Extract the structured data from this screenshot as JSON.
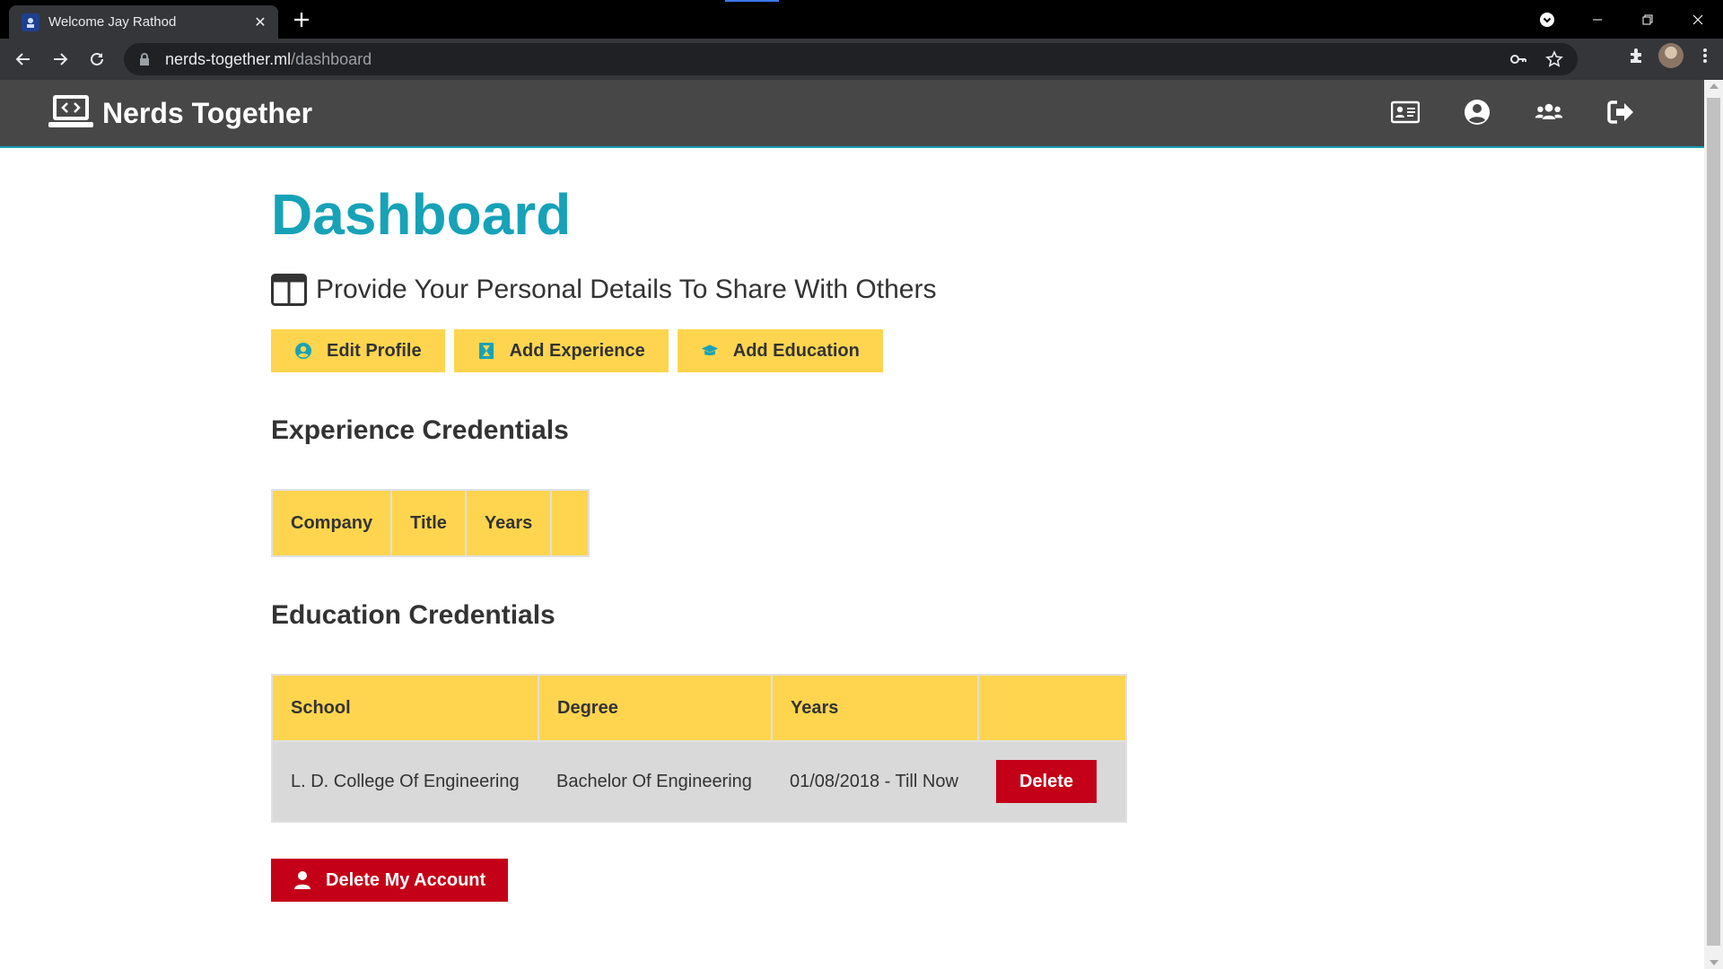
{
  "browser": {
    "tab_title": "Welcome Jay Rathod",
    "url_host": "nerds-together.ml",
    "url_path": "/dashboard"
  },
  "app": {
    "brand": "Nerds Together",
    "nav_icons": [
      "id-card-icon",
      "user-circle-icon",
      "users-icon",
      "sign-out-icon"
    ]
  },
  "page": {
    "title": "Dashboard",
    "lead": "Provide Your Personal Details To Share With Others",
    "buttons": {
      "edit_profile": "Edit Profile",
      "add_experience": "Add Experience",
      "add_education": "Add Education"
    }
  },
  "experience": {
    "title": "Experience Credentials",
    "headers": [
      "Company",
      "Title",
      "Years",
      ""
    ]
  },
  "education": {
    "title": "Education Credentials",
    "headers": [
      "School",
      "Degree",
      "Years",
      ""
    ],
    "rows": [
      {
        "school": "L. D. College Of Engineering",
        "degree": "Bachelor Of Engineering",
        "years": "01/08/2018 - Till Now",
        "action": "Delete"
      }
    ]
  },
  "delete_account": "Delete My Account",
  "colors": {
    "primary": "#17a2b8",
    "light": "#ffd54f",
    "danger": "#c30017",
    "navbar": "#474747"
  }
}
